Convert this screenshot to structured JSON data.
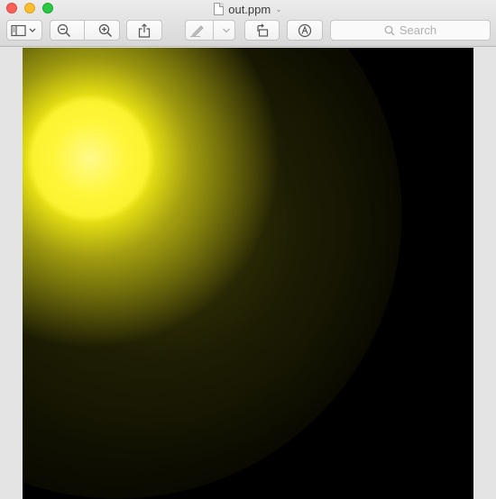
{
  "window": {
    "title": "out.ppm",
    "title_chevron": "⌄"
  },
  "toolbar": {
    "search_placeholder": "Search",
    "icons": {
      "sidebar": "sidebar-toggle-icon",
      "zoom_out": "zoom-out-icon",
      "zoom_in": "zoom-in-icon",
      "share": "share-icon",
      "markup": "pen-icon",
      "rotate": "rotate-icon",
      "annotate": "annotate-icon",
      "search": "search-icon"
    }
  },
  "image": {
    "description_colors": {
      "glow": "#fff63c",
      "sphere": "#1a1a03",
      "background": "#000000"
    }
  }
}
